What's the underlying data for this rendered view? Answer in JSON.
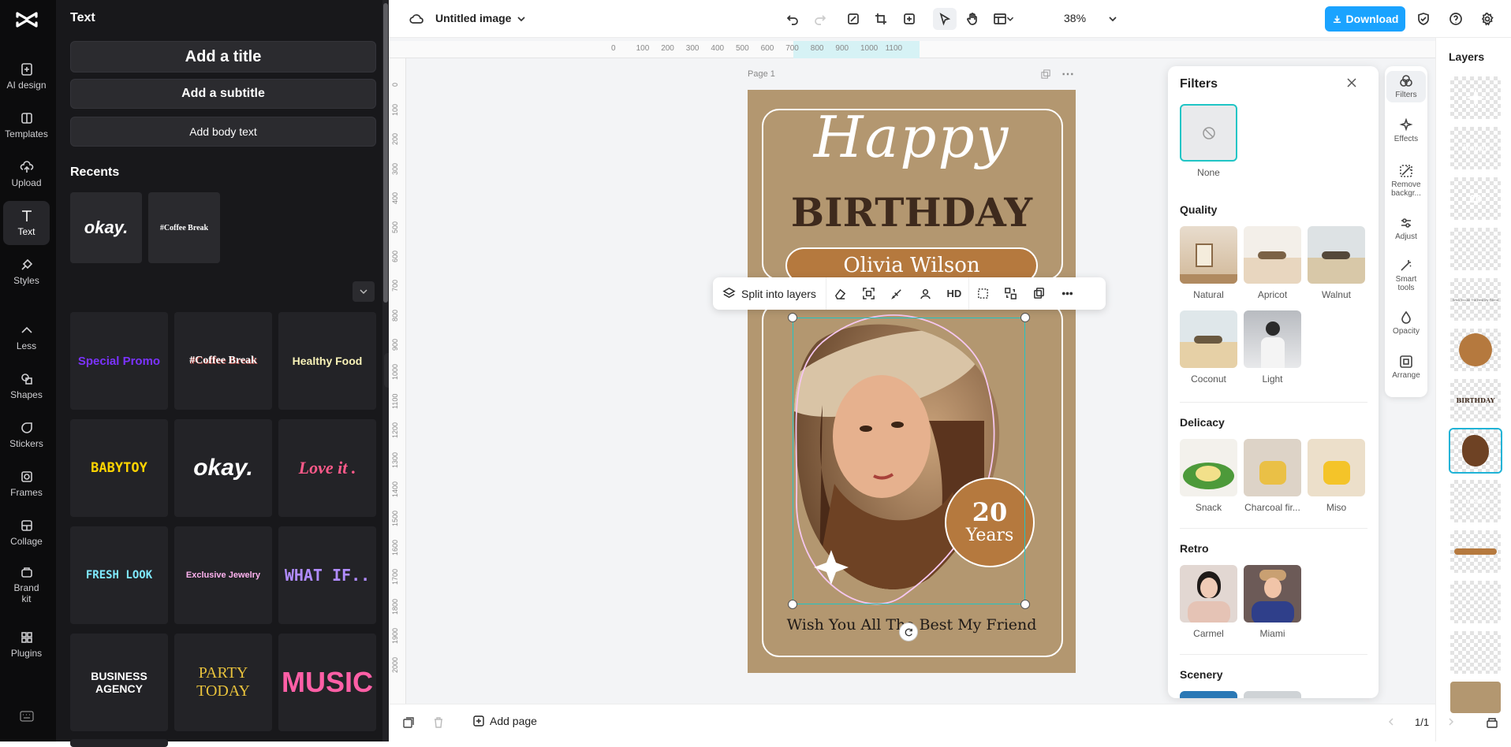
{
  "nav": {
    "items": [
      {
        "label": "AI design",
        "icon": "ai-design-icon"
      },
      {
        "label": "Templates",
        "icon": "templates-icon"
      },
      {
        "label": "Upload",
        "icon": "upload-icon"
      },
      {
        "label": "Text",
        "icon": "text-icon"
      },
      {
        "label": "Styles",
        "icon": "styles-icon"
      },
      {
        "label": "Less",
        "icon": "chevron-up-icon"
      },
      {
        "label": "Shapes",
        "icon": "shapes-icon"
      },
      {
        "label": "Stickers",
        "icon": "stickers-icon"
      },
      {
        "label": "Frames",
        "icon": "frames-icon"
      },
      {
        "label": "Collage",
        "icon": "collage-icon"
      },
      {
        "label": "Brand kit",
        "icon": "brand-kit-icon"
      },
      {
        "label": "Plugins",
        "icon": "plugins-icon"
      }
    ]
  },
  "panel": {
    "title": "Text",
    "add_title": "Add a title",
    "add_subtitle": "Add a subtitle",
    "add_body": "Add body text",
    "recents_title": "Recents",
    "recents": [
      "okay.",
      "#Coffee Break"
    ],
    "templates": [
      "Special Promo",
      "#Coffee Break",
      "Healthy Food",
      "BABYTOY",
      "okay.",
      "Love it .",
      "FRESH LOOK",
      "Exclusive Jewelry",
      "WHAT IF..",
      "BUSINESS AGENCY",
      "PARTY TODAY",
      "MUSIC"
    ]
  },
  "topbar": {
    "doc_title": "Untitled image",
    "zoom": "38%",
    "download_label": "Download"
  },
  "ruler": {
    "h_ticks": [
      "0",
      "100",
      "200",
      "300",
      "400",
      "500",
      "600",
      "700",
      "800",
      "900",
      "1000",
      "1100"
    ],
    "v_ticks": [
      "0",
      "100",
      "200",
      "300",
      "400",
      "500",
      "600",
      "700",
      "800",
      "900",
      "1000",
      "1100",
      "1200",
      "1300",
      "1400",
      "1500",
      "1600",
      "1700",
      "1800",
      "1900",
      "2000"
    ]
  },
  "canvas": {
    "page_label": "Page 1",
    "happy": "Happy",
    "birthday": "BIRTHDAY",
    "name": "Olivia Wilson",
    "years_num": "20",
    "years_word": "Years",
    "wish": "Wish You All The Best My Friend"
  },
  "context_toolbar": {
    "split_label": "Split into layers",
    "hd_label": "HD"
  },
  "filters": {
    "title": "Filters",
    "none_label": "None",
    "sections": [
      {
        "title": "Quality",
        "items": [
          "Natural",
          "Apricot",
          "Walnut",
          "Coconut",
          "Light"
        ]
      },
      {
        "title": "Delicacy",
        "items": [
          "Snack",
          "Charcoal fir...",
          "Miso"
        ]
      },
      {
        "title": "Retro",
        "items": [
          "Carmel",
          "Miami"
        ]
      },
      {
        "title": "Scenery",
        "items": []
      }
    ]
  },
  "tools": [
    {
      "label": "Filters",
      "icon": "filters-icon"
    },
    {
      "label": "Effects",
      "icon": "effects-icon"
    },
    {
      "label": "Remove backgr...",
      "icon": "remove-background-icon"
    },
    {
      "label": "Adjust",
      "icon": "adjust-icon"
    },
    {
      "label": "Smart tools",
      "icon": "smart-tools-icon"
    },
    {
      "label": "Opacity",
      "icon": "opacity-icon"
    },
    {
      "label": "Arrange",
      "icon": "arrange-icon"
    }
  ],
  "layers": {
    "title": "Layers"
  },
  "bottombar": {
    "add_page": "Add page",
    "page_count": "1/1"
  },
  "colors": {
    "accent": "#1aa3ff",
    "canvas_bg": "#b39770",
    "selection": "#20c5c5",
    "birthday_text": "#3e2a1d",
    "name_pill": "#b5793e"
  }
}
